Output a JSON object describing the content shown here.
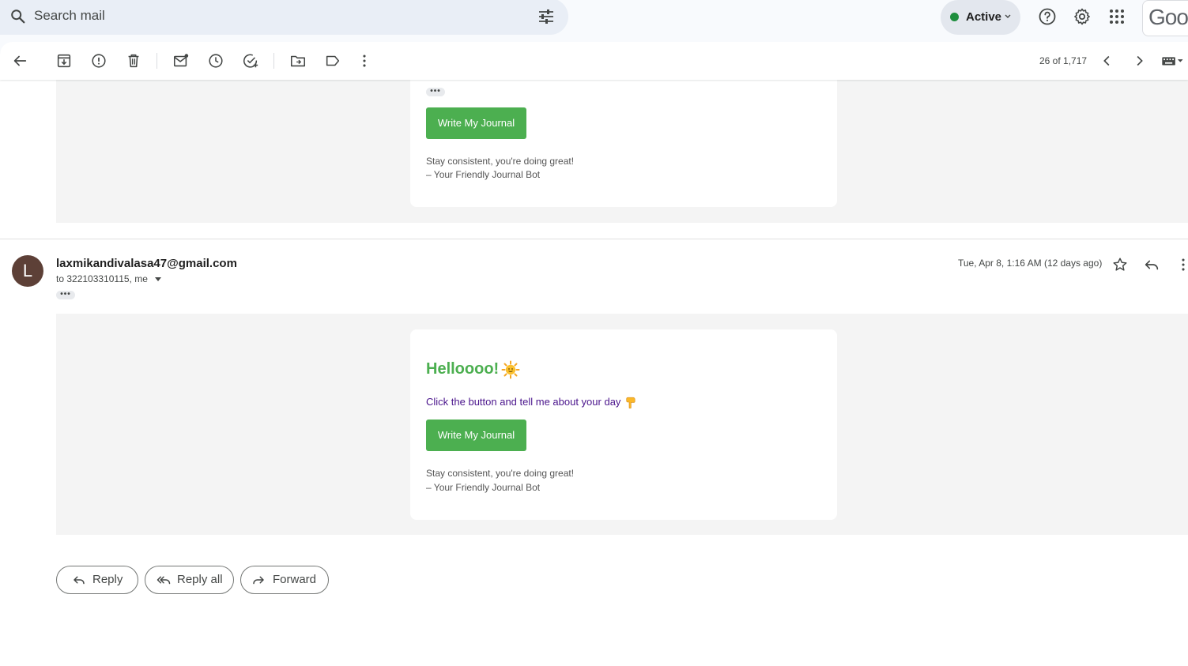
{
  "search": {
    "placeholder": "Search mail"
  },
  "status": {
    "label": "Active",
    "color": "#1e8e3e"
  },
  "account": {
    "logo_text": "Goo"
  },
  "toolbar": {
    "pager": "26 of 1,717"
  },
  "message1": {
    "button_label": "Write My Journal",
    "footer_line1": "Stay consistent, you're doing great!",
    "footer_line2": "– Your Friendly Journal Bot",
    "ellipsis": "•••"
  },
  "message2": {
    "avatar_letter": "L",
    "sender": "laxmikandivalasa47@gmail.com",
    "recipients": "to 322103310115, me",
    "date": "Tue, Apr 8, 1:16 AM (12 days ago)",
    "ellipsis": "•••",
    "heading": "Helloooo!",
    "prompt": "Click the button and tell me about your day",
    "button_label": "Write My Journal",
    "footer_line1": "Stay consistent, you're doing great!",
    "footer_line2": "– Your Friendly Journal Bot",
    "accent_color": "#4caf50"
  },
  "actions": {
    "reply": "Reply",
    "reply_all": "Reply all",
    "forward": "Forward"
  }
}
